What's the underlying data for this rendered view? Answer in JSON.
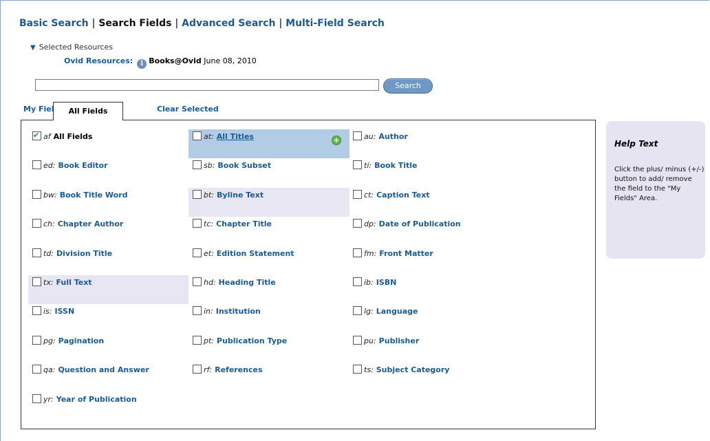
{
  "nav": {
    "basic": "Basic Search",
    "fields": "Search Fields",
    "advanced": "Advanced Search",
    "multi": "Multi-Field Search",
    "sep": "|"
  },
  "resources": {
    "toggle": "Selected Resources",
    "label": "Ovid Resources:",
    "name": "Books@Ovid",
    "date": "June 08, 2010"
  },
  "search": {
    "value": "",
    "button": "Search"
  },
  "tabs": {
    "my_fields": "My Fields",
    "all_fields": "All Fields",
    "clear": "Clear Selected"
  },
  "fields": [
    {
      "code": "af",
      "name": "All Fields",
      "checked": true
    },
    {
      "code": "at:",
      "name": "All Titles",
      "checked": false
    },
    {
      "code": "au:",
      "name": "Author",
      "checked": false
    },
    {
      "code": "ed:",
      "name": "Book Editor",
      "checked": false
    },
    {
      "code": "sb:",
      "name": "Book Subset",
      "checked": false
    },
    {
      "code": "ti:",
      "name": "Book Title",
      "checked": false
    },
    {
      "code": "bw:",
      "name": "Book Title Word",
      "checked": false
    },
    {
      "code": "bt:",
      "name": "Byline Text",
      "checked": false
    },
    {
      "code": "ct:",
      "name": "Caption Text",
      "checked": false
    },
    {
      "code": "ch:",
      "name": "Chapter Author",
      "checked": false
    },
    {
      "code": "tc:",
      "name": "Chapter Title",
      "checked": false
    },
    {
      "code": "dp:",
      "name": "Date of Publication",
      "checked": false
    },
    {
      "code": "td:",
      "name": "Division Title",
      "checked": false
    },
    {
      "code": "et:",
      "name": "Edition Statement",
      "checked": false
    },
    {
      "code": "fm:",
      "name": "Front Matter",
      "checked": false
    },
    {
      "code": "tx:",
      "name": "Full Text",
      "checked": false
    },
    {
      "code": "hd:",
      "name": "Heading Title",
      "checked": false
    },
    {
      "code": "ib:",
      "name": "ISBN",
      "checked": false
    },
    {
      "code": "is:",
      "name": "ISSN",
      "checked": false
    },
    {
      "code": "in:",
      "name": "Institution",
      "checked": false
    },
    {
      "code": "lg:",
      "name": "Language",
      "checked": false
    },
    {
      "code": "pg:",
      "name": "Pagination",
      "checked": false
    },
    {
      "code": "pt:",
      "name": "Publication Type",
      "checked": false
    },
    {
      "code": "pu:",
      "name": "Publisher",
      "checked": false
    },
    {
      "code": "qa:",
      "name": "Question and Answer",
      "checked": false
    },
    {
      "code": "rf:",
      "name": "References",
      "checked": false
    },
    {
      "code": "ts:",
      "name": "Subject Category",
      "checked": false
    },
    {
      "code": "yr:",
      "name": "Year of Publication",
      "checked": false
    }
  ],
  "help": {
    "title": "Help Text",
    "body": "Click the plus/ minus (+/-) button to add/ remove the field to the \"My Fields\" Area."
  },
  "colors": {
    "link": "#1a5a94",
    "hover_cell": "#b3cce6",
    "highlight_cell": "#e8e6f2",
    "help_bg": "#e6e4f1",
    "button": "#6f98c4"
  },
  "icons": {
    "info": "info-icon",
    "plus": "plus-circle-icon",
    "toggle": "triangle-down-icon"
  }
}
